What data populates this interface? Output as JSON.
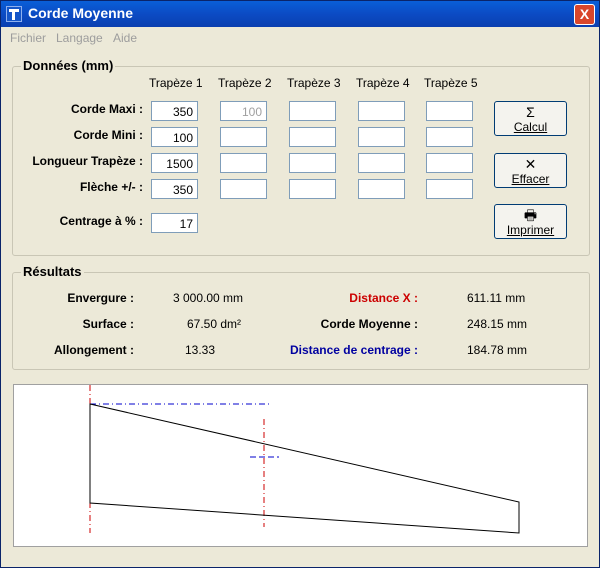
{
  "window": {
    "title": "Corde Moyenne",
    "close_glyph": "X"
  },
  "menu": [
    "Fichier",
    "Langage",
    "Aide"
  ],
  "donnees": {
    "title": "Données (mm)",
    "columns": [
      "Trapèze 1",
      "Trapèze 2",
      "Trapèze 3",
      "Trapèze 4",
      "Trapèze 5"
    ],
    "rows": [
      {
        "label": "Corde Maxi :",
        "values": [
          "350",
          "100",
          "",
          "",
          ""
        ]
      },
      {
        "label": "Corde Mini :",
        "values": [
          "100",
          "",
          "",
          "",
          ""
        ]
      },
      {
        "label": "Longueur Trapèze :",
        "values": [
          "1500",
          "",
          "",
          "",
          ""
        ]
      },
      {
        "label": "Flèche +/- :",
        "values": [
          "350",
          "",
          "",
          "",
          ""
        ]
      }
    ],
    "centrage_label": "Centrage à % :",
    "centrage_value": "17"
  },
  "buttons": [
    {
      "label": "Calcul",
      "icon": "sigma-icon",
      "glyph": "Σ"
    },
    {
      "label": "Effacer",
      "icon": "eraser-x-icon",
      "glyph": "✕"
    },
    {
      "label": "Imprimer",
      "icon": "printer-icon",
      "glyph": "🖶"
    }
  ],
  "resultats": {
    "title": "Résultats",
    "left": [
      {
        "label": "Envergure :",
        "value": "3 000.00 mm"
      },
      {
        "label": "Surface :",
        "value": "67.50 dm²"
      },
      {
        "label": "Allongement :",
        "value": "13.33"
      }
    ],
    "right": [
      {
        "label": "Distance X :",
        "value": "611.11 mm",
        "color": "#cc0000"
      },
      {
        "label": "Corde Moyenne :",
        "value": "248.15 mm",
        "color": "#000000"
      },
      {
        "label": "Distance de centrage :",
        "value": "184.78 mm",
        "color": "#0000a0"
      }
    ]
  },
  "colors": {
    "red_line": "#cc0000",
    "blue_line": "#0000cc"
  }
}
